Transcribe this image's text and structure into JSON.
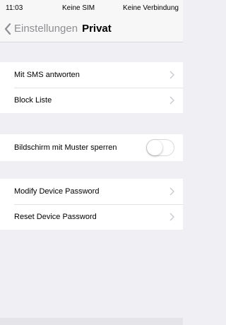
{
  "status": {
    "time": "11:03",
    "carrier": "Keine SIM",
    "network": "Keine Verbindung"
  },
  "nav": {
    "back_label": "Einstellungen",
    "title": "Privat"
  },
  "group1": [
    {
      "label": "Mit SMS antworten"
    },
    {
      "label": "Block Liste"
    }
  ],
  "group2": {
    "label": "Bildschirm mit Muster sperren",
    "toggle_on": false
  },
  "group3": [
    {
      "label": "Modify Device Password"
    },
    {
      "label": "Reset Device Password"
    }
  ],
  "colors": {
    "background": "#efeff4",
    "chevron": "#c7c7cc",
    "back": "#8e8e93"
  }
}
